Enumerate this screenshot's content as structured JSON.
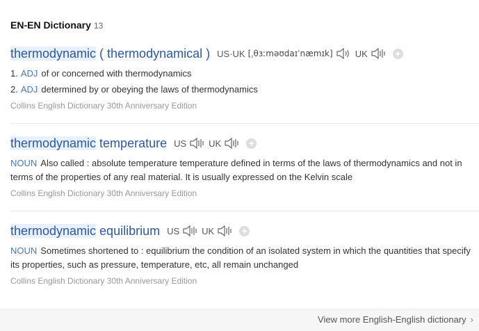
{
  "header": {
    "title": "EN-EN Dictionary",
    "count": "13"
  },
  "entries": [
    {
      "hw_highlight": "thermodynamic",
      "hw_rest": " ( thermodynamical )",
      "pron_label": "US·UK",
      "ipa": "[ˌθɜːməʊdaɪˈnæmɪk]",
      "uk_label": "UK",
      "senses": [
        {
          "num": "1.",
          "pos": "ADJ",
          "text": "of or concerned with thermodynamics"
        },
        {
          "num": "2.",
          "pos": "ADJ",
          "text": "determined by or obeying the laws of thermodynamics"
        }
      ],
      "source": "Collins English Dictionary 30th Anniversary Edition"
    },
    {
      "hw_highlight": "thermodynamic",
      "hw_rest": " temperature",
      "us_label": "US",
      "uk_label": "UK",
      "pos": "NOUN",
      "text": "Also called : absolute temperature temperature defined in terms of the laws of thermodynamics and not in terms of the properties of any real material. It is usually expressed on the Kelvin scale",
      "source": "Collins English Dictionary 30th Anniversary Edition"
    },
    {
      "hw_highlight": "thermodynamic",
      "hw_rest": " equilibrium",
      "us_label": "US",
      "uk_label": "UK",
      "pos": "NOUN",
      "text": "Sometimes shortened to : equilibrium the condition of an isolated system in which the quantities that specify its properties, such as pressure, temperature, etc, all remain unchanged",
      "source": "Collins English Dictionary 30th Anniversary Edition"
    }
  ],
  "footer": {
    "more_label": "View more English-English dictionary",
    "chevron": "›"
  }
}
